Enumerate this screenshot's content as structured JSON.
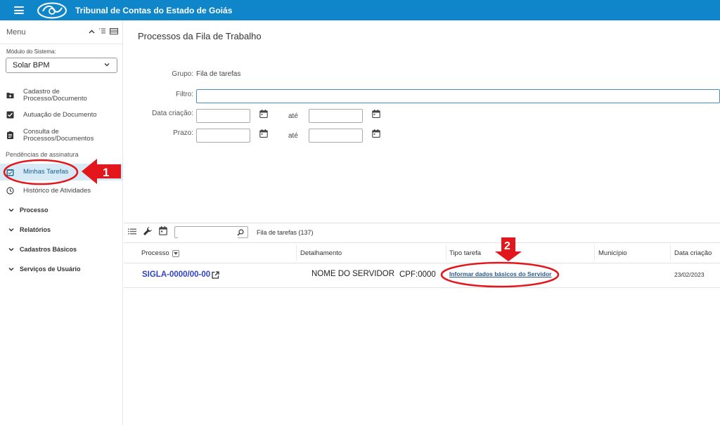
{
  "header": {
    "title": "Tribunal de Contas do Estado de Goiás",
    "bar_color": "#0f86c9"
  },
  "sidebar": {
    "menu_label": "Menu",
    "module_label": "Módulo do Sistema:",
    "module_value": "Solar BPM",
    "items": [
      {
        "label_1": "Cadastro de",
        "label_2": "Processo/Documento",
        "icon": "folder-plus-icon"
      },
      {
        "label": "Autuação de Documento",
        "icon": "checkbox-icon"
      },
      {
        "label_1": "Consulta de",
        "label_2": "Processos/Documentos",
        "icon": "clipboard-icon"
      }
    ],
    "section_label": "Pendências de assinatura",
    "active_item": {
      "label": "Minhas Tarefas",
      "icon": "task-check-icon"
    },
    "history_item": {
      "label": "Histórico de Atividades",
      "icon": "clock-icon"
    },
    "groups": [
      "Processo",
      "Relatórios",
      "Cadastros Básicos",
      "Serviços de Usuário"
    ]
  },
  "main": {
    "title": "Processos da Fila de Trabalho",
    "form": {
      "group_label": "Grupo:",
      "group_value": "Fila de tarefas",
      "filter_label": "Filtro:",
      "filter_value": "",
      "created_label": "Data criação:",
      "deadline_label": "Prazo:",
      "until_label": "até"
    },
    "toolbar": {
      "search_value": "",
      "count_text": "Fila de tarefas (137)"
    },
    "table": {
      "columns": [
        "Processo",
        "Detalhamento",
        "Tipo tarefa",
        "Município",
        "Data criação"
      ],
      "rows": [
        {
          "processo": "SIGLA-0000/00-00",
          "detalhamento": "NOME DO SERVIDOR",
          "cpf": "CPF:0000",
          "tipo_tarefa": "Informar dados básicos do Servidor",
          "municipio": "",
          "data_criacao": "23/02/2023"
        }
      ]
    }
  },
  "annotations": {
    "marker_1": "1",
    "marker_2": "2",
    "color": "#e3161b"
  }
}
